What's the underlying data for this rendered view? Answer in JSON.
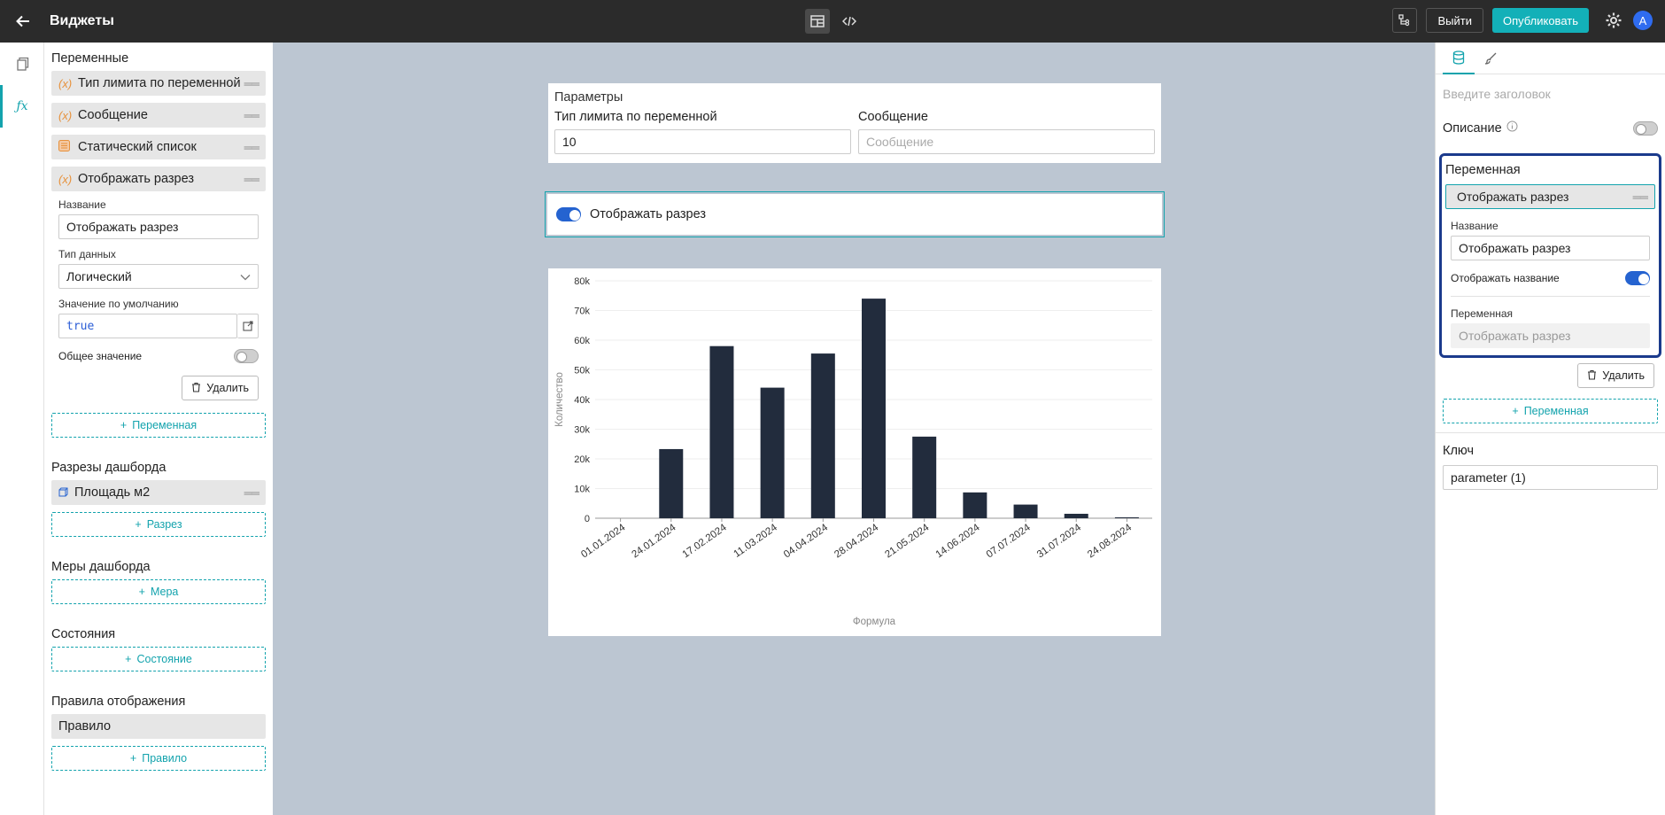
{
  "header": {
    "title": "Виджеты",
    "exit_label": "Выйти",
    "publish_label": "Опубликовать",
    "avatar_letter": "A"
  },
  "left": {
    "variables_title": "Переменные",
    "variables": [
      {
        "label": "Тип лимита по переменной",
        "icon": "variable-icon"
      },
      {
        "label": "Сообщение",
        "icon": "variable-icon"
      },
      {
        "label": "Статический список",
        "icon": "list-icon"
      },
      {
        "label": "Отображать разрез",
        "icon": "variable-icon"
      }
    ],
    "name_label": "Название",
    "name_value": "Отображать разрез",
    "type_label": "Тип данных",
    "type_value": "Логический",
    "default_label": "Значение по умолчанию",
    "default_value": "true",
    "shared_label": "Общее значение",
    "delete_label": "Удалить",
    "add_variable_label": "Переменная",
    "dims_title": "Разрезы дашборда",
    "dims": [
      {
        "label": "Площадь м2"
      }
    ],
    "add_dim_label": "Разрез",
    "measures_title": "Меры дашборда",
    "add_measure_label": "Мера",
    "states_title": "Состояния",
    "add_state_label": "Состояние",
    "rules_title": "Правила отображения",
    "rule_item": "Правило",
    "add_rule_label": "Правило"
  },
  "params": {
    "title": "Параметры",
    "field1_label": "Тип лимита по переменной",
    "field1_value": "10",
    "field2_label": "Сообщение",
    "field2_placeholder": "Сообщение"
  },
  "toggle_widget": {
    "label": "Отображать разрез",
    "checked": true
  },
  "chart_data": {
    "type": "bar",
    "categories": [
      "01.01.2024",
      "24.01.2024",
      "17.02.2024",
      "11.03.2024",
      "04.04.2024",
      "28.04.2024",
      "21.05.2024",
      "14.06.2024",
      "07.07.2024",
      "31.07.2024",
      "24.08.2024"
    ],
    "values": [
      0,
      23300,
      58000,
      44000,
      55500,
      74000,
      27500,
      8700,
      4600,
      1500,
      300
    ],
    "xlabel": "Формула",
    "ylabel": "Количество",
    "ylim": [
      0,
      80000
    ],
    "yticks": [
      "0",
      "10k",
      "20k",
      "30k",
      "40k",
      "50k",
      "60k",
      "70k",
      "80k"
    ],
    "bar_color": "#222c3d",
    "grid": true
  },
  "right": {
    "title_placeholder": "Введите заголовок",
    "description_label": "Описание",
    "var_title": "Переменная",
    "var_selected": "Отображать разрез",
    "name_label": "Название",
    "name_value": "Отображать разрез",
    "show_name_label": "Отображать название",
    "var2_label": "Переменная",
    "var2_value": "Отображать разрез",
    "delete_label": "Удалить",
    "add_variable_label": "Переменная",
    "key_label": "Ключ",
    "key_value": "parameter (1)"
  }
}
